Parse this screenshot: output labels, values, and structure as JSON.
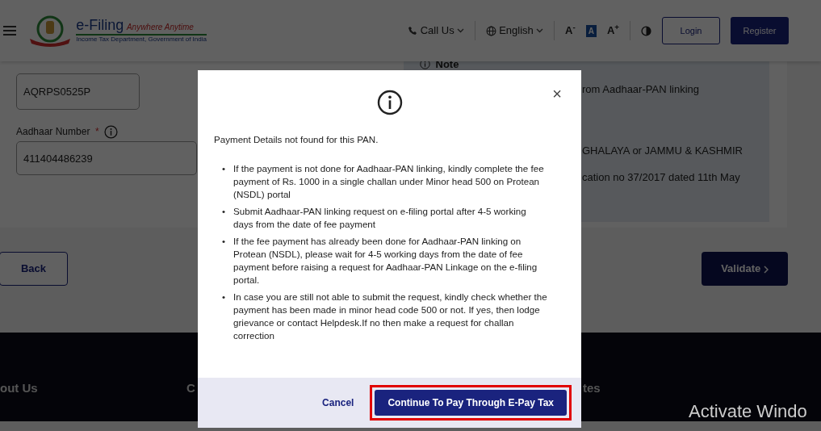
{
  "header": {
    "logo_title": "e-Filing",
    "logo_tagline": "Anywhere Anytime",
    "logo_subtitle": "Income Tax Department, Government of India",
    "call_us": "Call Us",
    "language": "English",
    "text_size": [
      "A$^{-}$",
      "A",
      "A$^{+}$"
    ],
    "login": "Login",
    "register": "Register"
  },
  "form": {
    "pan_value": "AQRPS0525P",
    "aadhaar_label": "Aadhaar Number",
    "required_mark": "*",
    "aadhaar_value": "411404486239"
  },
  "note": {
    "title": "Note",
    "lines": [
      "rom Aadhaar-PAN linking",
      "GHALAYA or JAMMU & KASHMIR",
      "cation no 37/2017 dated 11th May"
    ]
  },
  "actions": {
    "back": "Back",
    "validate": "Validate"
  },
  "footer": {
    "headings": [
      "out Us",
      "C",
      "tes"
    ],
    "watermark": "Activate Windo"
  },
  "modal": {
    "message": "Payment Details not found for this PAN.",
    "close": "×",
    "bullet": "•",
    "bullets": [
      "If the payment is not done for Aadhaar-PAN linking, kindly complete the fee payment of Rs. 1000 in a single challan under Minor head 500 on Protean (NSDL) portal",
      "Submit Aadhaar-PAN linking request on e-filing portal after 4-5 working days from the date of fee payment",
      "If the fee payment has already been done for Aadhaar-PAN linking on Protean (NSDL), please wait for 4-5 working days from the date of fee payment before raising a request for Aadhaar-PAN Linkage on the e-filing portal.",
      "In case you are still not able to submit the request, kindly check whether the payment has been made in minor head code 500 or not. If yes, then lodge grievance or contact Helpdesk.If no then make a request for challan correction"
    ],
    "cancel": "Cancel",
    "continue": "Continue To Pay Through E-Pay Tax",
    "continue_highlighted": true
  }
}
